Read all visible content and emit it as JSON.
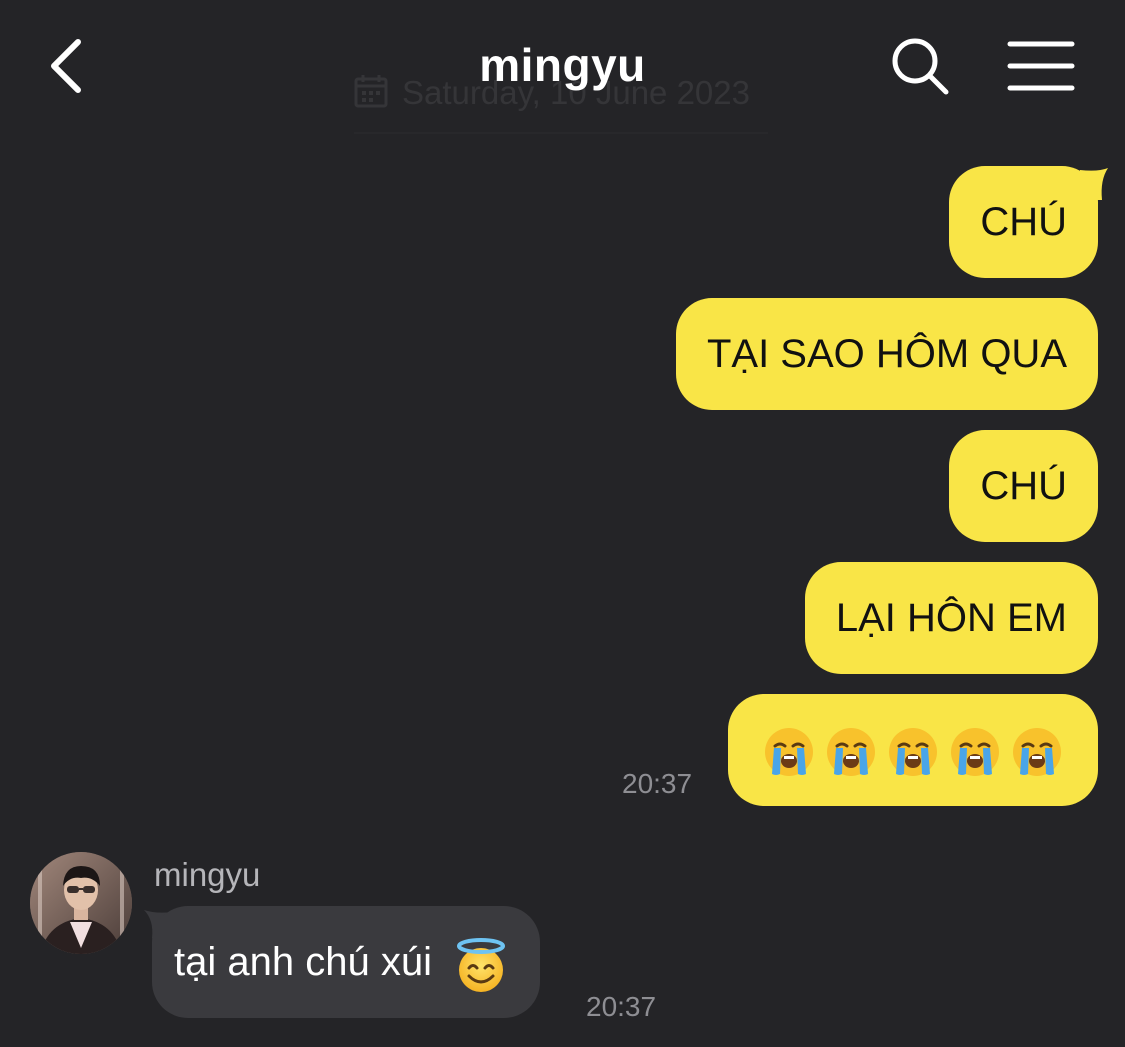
{
  "header": {
    "title": "mingyu",
    "back_icon": "chevron-left-icon",
    "search_icon": "search-icon",
    "menu_icon": "hamburger-menu-icon"
  },
  "date_divider": {
    "text": "Saturday, 10 June 2023",
    "icon": "calendar-icon"
  },
  "outgoing_messages": [
    {
      "text": "CHÚ"
    },
    {
      "text": "TẠI SAO HÔM QUA"
    },
    {
      "text": "CHÚ"
    },
    {
      "text": "LẠI HÔN EM"
    },
    {
      "emoji": "loudly-crying-face",
      "count": 5
    }
  ],
  "outgoing_time": "20:37",
  "incoming_message": {
    "sender": "mingyu",
    "text": "tại anh chú xúi",
    "emoji": "smiling-face-with-halo",
    "time": "20:37"
  },
  "colors": {
    "background": "#242427",
    "outgoing_bubble": "#f9e547",
    "incoming_bubble": "#3a3a3e",
    "timestamp": "#8e8e93"
  }
}
